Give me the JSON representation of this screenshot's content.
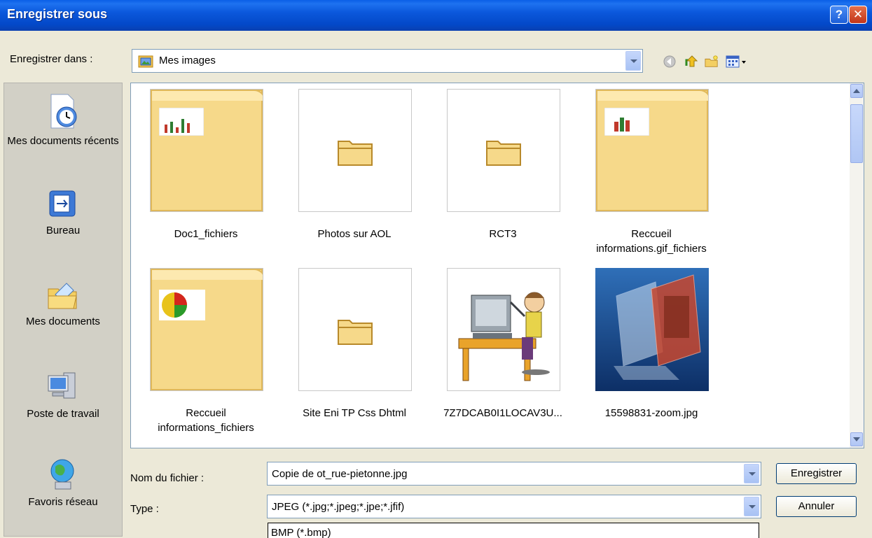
{
  "window": {
    "title": "Enregistrer sous",
    "help_glyph": "?",
    "close_glyph": "✕"
  },
  "lookin": {
    "label": "Enregistrer dans :",
    "value": "Mes images"
  },
  "places": [
    {
      "label": "Mes documents récents",
      "icon": "recent-documents-icon"
    },
    {
      "label": "Bureau",
      "icon": "desktop-icon"
    },
    {
      "label": "Mes documents",
      "icon": "my-documents-icon"
    },
    {
      "label": "Poste de travail",
      "icon": "my-computer-icon"
    },
    {
      "label": "Favoris réseau",
      "icon": "network-places-icon"
    }
  ],
  "files": [
    {
      "name": "Doc1_fichiers",
      "kind": "folder-thumbnail"
    },
    {
      "name": "Photos sur AOL",
      "kind": "folder"
    },
    {
      "name": "RCT3",
      "kind": "folder"
    },
    {
      "name": "Reccueil informations.gif_fichiers",
      "kind": "folder-thumbnail"
    },
    {
      "name": "Reccueil informations_fichiers",
      "kind": "folder-thumbnail"
    },
    {
      "name": "Site Eni TP Css Dhtml",
      "kind": "folder"
    },
    {
      "name": "7Z7DCAB0I1LOCAV3U...",
      "kind": "image"
    },
    {
      "name": "15598831-zoom.jpg",
      "kind": "image"
    }
  ],
  "filename": {
    "label": "Nom du fichier :",
    "value": "Copie de ot_rue-pietonne.jpg"
  },
  "filetype": {
    "label": "Type :",
    "value": "JPEG (*.jpg;*.jpeg;*.jpe;*.jfif)",
    "open_option": "BMP (*.bmp)"
  },
  "buttons": {
    "save": "Enregistrer",
    "cancel": "Annuler"
  },
  "colors": {
    "titlebar": "#0a5fe6",
    "dialog": "#ece9d8",
    "folder": "#f6d98a"
  }
}
